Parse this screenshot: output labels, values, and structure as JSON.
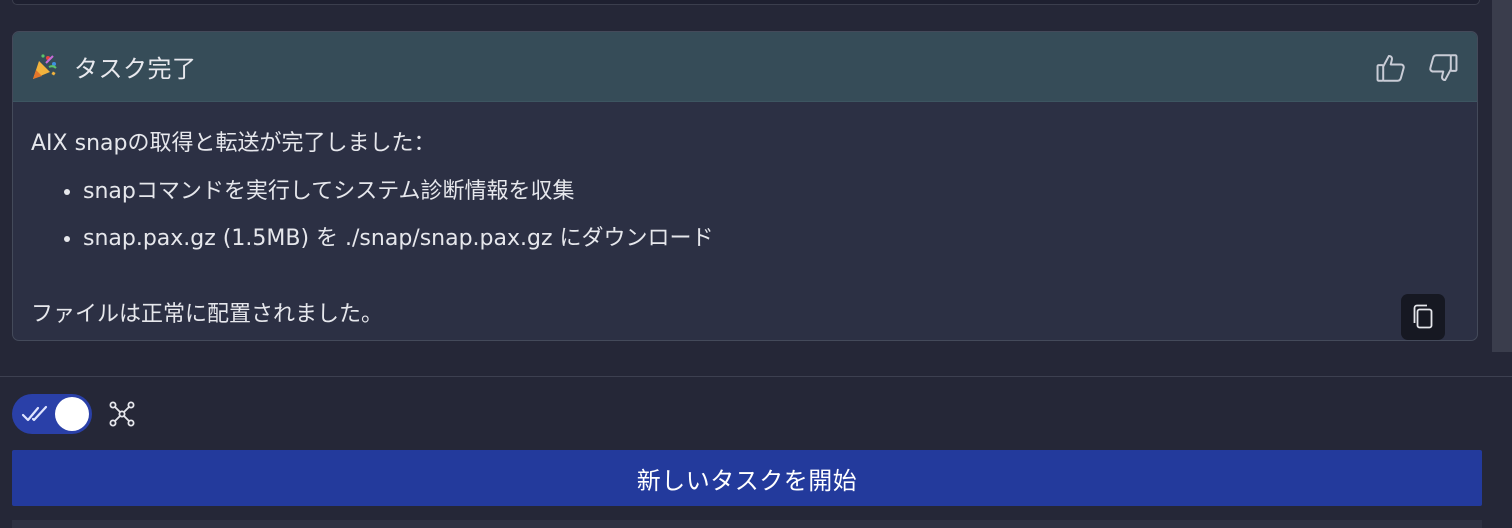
{
  "card": {
    "title": "タスク完了",
    "intro": "AIX snapの取得と転送が完了しました：",
    "bullets": [
      "snapコマンドを実行してシステム診断情報を収集",
      "snap.pax.gz (1.5MB) を ./snap/snap.pax.gz にダウンロード"
    ],
    "outro": "ファイルは正常に配置されました。"
  },
  "icons": {
    "header": "party-popper-icon",
    "feedback": [
      "thumbs-up-icon",
      "thumbs-down-icon"
    ],
    "copy": "copy-icon",
    "toggle": "double-check-icon",
    "graph": "graph-nodes-icon"
  },
  "toggle": {
    "state": "on"
  },
  "actions": {
    "start_label": "新しいタスクを開始"
  },
  "colors": {
    "background": "#252737",
    "card": "#2c3044",
    "card_header": "#364c58",
    "accent": "#233a9c",
    "toggle_on": "#2a40a8"
  }
}
